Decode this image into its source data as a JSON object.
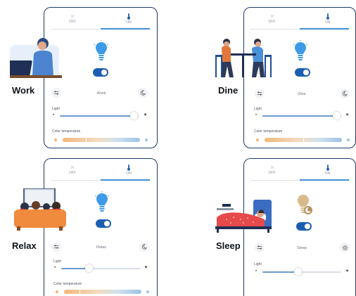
{
  "tabs": {
    "off": "OFF",
    "on": "ON"
  },
  "labels": {
    "light": "Light",
    "color_temperature": "Color temperature"
  },
  "colors": {
    "border": "#1d3a6b",
    "accent": "#1c5fb1",
    "bulb_on": "#3d9be9",
    "bulb_sleep": "#d8b98a",
    "warm": "#f2b77a",
    "cool": "#9cc3e3"
  },
  "scenes": [
    {
      "name": "Work",
      "caption": "Work",
      "light_level": 0.92,
      "color_temp_level": 0.3,
      "mode_icon": "moon-icon"
    },
    {
      "name": "Dine",
      "caption": "Dine",
      "light_level": 0.92,
      "color_temp_level": 0.5,
      "mode_icon": "moon-icon"
    },
    {
      "name": "Relax",
      "caption": "Relax",
      "light_level": 0.35,
      "color_temp_level": 0.2,
      "mode_icon": "moon-icon"
    },
    {
      "name": "Sleep",
      "caption": "Sleep",
      "light_level": 0.45,
      "color_temp_level": null,
      "mode_icon": "sun-icon"
    }
  ]
}
